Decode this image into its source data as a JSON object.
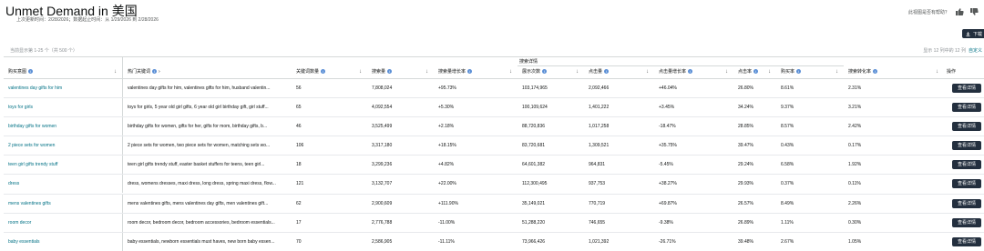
{
  "page": {
    "title": "Unmet Demand in 美国",
    "subtitle": "上次更新时间：2/28/2026；数据起止时间：从 1/29/2026 到 2/28/2026",
    "feedback_text": "此视图是否有帮助？",
    "thumbs_up_icon": "thumbs-up-icon",
    "thumbs_down_icon": "thumbs-down-icon",
    "download_label": "下载",
    "download_icon": "download-icon",
    "showing_left": "当前显示第 1-25 个（共 500 个）",
    "showing_right": "显示 12 列中的 12 列",
    "customize_label": "自定义"
  },
  "table": {
    "group_header": "搜索详情",
    "headers": {
      "keyword": "购买意图",
      "related": "热门关键词",
      "count": "关键词数量",
      "search_volume": "搜索量",
      "search_growth": "搜索量增长率",
      "impressions": "展示次数",
      "clicks": "点击量",
      "click_growth": "点击量增长率",
      "ctr": "点击率",
      "add_to_cart": "购买率",
      "conversion": "搜索转化率",
      "action": "操作"
    },
    "detail_label": "查看详情",
    "rows": [
      {
        "keyword": "valentines day gifts for him",
        "related": "valentines day gifts for him, valentines gifts for him, husband valentin...",
        "count": "56",
        "search_volume": "7,808,024",
        "search_growth": "+95.73%",
        "impressions": "103,174,965",
        "clicks": "2,092,466",
        "click_growth": "+46.04%",
        "ctr": "26.80%",
        "add_to_cart": "8.61%",
        "conversion": "2.31%"
      },
      {
        "keyword": "toys for girls",
        "related": "toys for girls, 5 year old girl gifts, 6 year old girl birthday gift, girl stuff...",
        "count": "65",
        "search_volume": "4,092,554",
        "search_growth": "+5.30%",
        "impressions": "100,109,624",
        "clicks": "1,401,222",
        "click_growth": "+3.45%",
        "ctr": "34.24%",
        "add_to_cart": "9.37%",
        "conversion": "3.21%"
      },
      {
        "keyword": "birthday gifts for women",
        "related": "birthday gifts for women, gifts for her, gifts for mom, birthday gifts, b...",
        "count": "46",
        "search_volume": "3,525,499",
        "search_growth": "+2.18%",
        "impressions": "88,720,836",
        "clicks": "1,017,258",
        "click_growth": "-18.47%",
        "ctr": "28.85%",
        "add_to_cart": "8.57%",
        "conversion": "2.42%"
      },
      {
        "keyword": "2 piece sets for women",
        "related": "2 piece sets for women, two piece sets for women, matching sets wo...",
        "count": "106",
        "search_volume": "3,317,180",
        "search_growth": "+18.15%",
        "impressions": "83,720,681",
        "clicks": "1,309,521",
        "click_growth": "+35.75%",
        "ctr": "39.47%",
        "add_to_cart": "0.43%",
        "conversion": "0.17%"
      },
      {
        "keyword": "teen girl gifts trendy stuff",
        "related": "teen girl gifts trendy stuff, easter basket stuffers for teens, teen girl...",
        "count": "18",
        "search_volume": "3,299,236",
        "search_growth": "+4.82%",
        "impressions": "64,601,382",
        "clicks": "964,831",
        "click_growth": "-5.45%",
        "ctr": "29.24%",
        "add_to_cart": "6.58%",
        "conversion": "1.92%"
      },
      {
        "keyword": "dress",
        "related": "dress, womens dresses, maxi dress, long dress, spring maxi dress, flow...",
        "count": "121",
        "search_volume": "3,132,707",
        "search_growth": "+22.00%",
        "impressions": "112,300,495",
        "clicks": "937,753",
        "click_growth": "+38.27%",
        "ctr": "29.93%",
        "add_to_cart": "0.37%",
        "conversion": "0.11%"
      },
      {
        "keyword": "mens valentines gifts",
        "related": "mens valentines gifts, mens valentines day gifts, men valentines gift...",
        "count": "62",
        "search_volume": "2,900,609",
        "search_growth": "+111.90%",
        "impressions": "35,149,021",
        "clicks": "770,719",
        "click_growth": "+69.87%",
        "ctr": "26.57%",
        "add_to_cart": "8.49%",
        "conversion": "2.26%"
      },
      {
        "keyword": "room decor",
        "related": "room decor, bedroom decor, bedroom accessories, bedroom essentials...",
        "count": "17",
        "search_volume": "2,776,788",
        "search_growth": "-11.00%",
        "impressions": "51,288,220",
        "clicks": "746,655",
        "click_growth": "-9.38%",
        "ctr": "26.89%",
        "add_to_cart": "1.11%",
        "conversion": "0.30%"
      },
      {
        "keyword": "baby essentials",
        "related": "baby essentials, newborn essentials must haves, new born baby essen...",
        "count": "70",
        "search_volume": "2,586,905",
        "search_growth": "-11.11%",
        "impressions": "73,966,426",
        "clicks": "1,021,392",
        "click_growth": "-26.71%",
        "ctr": "39.48%",
        "add_to_cart": "2.67%",
        "conversion": "1.05%"
      }
    ]
  }
}
